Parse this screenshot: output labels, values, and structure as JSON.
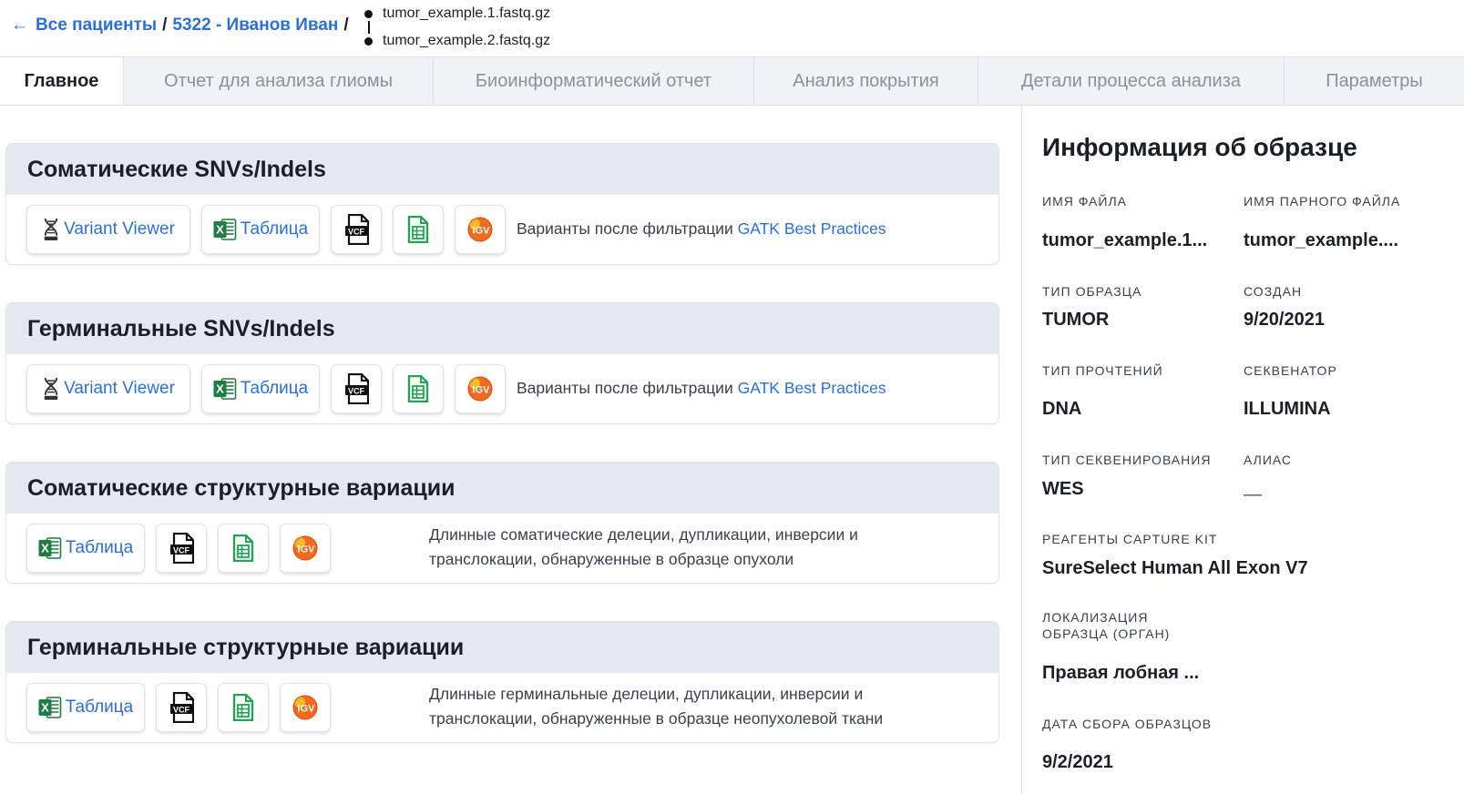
{
  "breadcrumb": {
    "back_label": "Все пациенты",
    "patient_label": "5322 - Иванов Иван",
    "separator": "/"
  },
  "files": [
    "tumor_example.1.fastq.gz",
    "tumor_example.2.fastq.gz"
  ],
  "tabs": [
    {
      "label": "Главное",
      "active": true
    },
    {
      "label": "Отчет для анализа глиомы",
      "active": false
    },
    {
      "label": "Биоинформатический отчет",
      "active": false
    },
    {
      "label": "Анализ покрытия",
      "active": false
    },
    {
      "label": "Детали процесса анализа",
      "active": false
    },
    {
      "label": "Параметры",
      "active": false
    }
  ],
  "sections": [
    {
      "title": "Соматические SNVs/Indels",
      "variant_viewer_label": "Variant Viewer",
      "table_label": "Таблица",
      "desc_prefix": "Варианты после фильтрации",
      "desc_link": "GATK Best Practices"
    },
    {
      "title": "Герминальные SNVs/Indels",
      "variant_viewer_label": "Variant Viewer",
      "table_label": "Таблица",
      "desc_prefix": "Варианты после фильтрации",
      "desc_link": "GATK Best Practices"
    },
    {
      "title": "Соматические структурные вариации",
      "table_label": "Таблица",
      "desc_line1": "Длинные соматические делеции, дупликации, инверсии и",
      "desc_line2": "транслокации, обнаруженные в образце опухоли"
    },
    {
      "title": "Герминальные структурные вариации",
      "table_label": "Таблица",
      "desc_line1": "Длинные герминальные делеции, дупликации, инверсии и",
      "desc_line2": "транслокации, обнаруженные в образце неопухолевой ткани"
    }
  ],
  "icons": {
    "vcf": "VCF",
    "igv": "IGV",
    "excel": "X"
  },
  "sample_info": {
    "title": "Информация об образце",
    "file_name_label": "Имя файла",
    "file_name_value": "tumor_example.1...",
    "pair_file_label": "Имя парного файла",
    "pair_file_value": "tumor_example....",
    "sample_type_label": "Тип образца",
    "sample_type_value": "TUMOR",
    "created_label": "Создан",
    "created_value": "9/20/2021",
    "read_type_label": "Тип прочтений",
    "read_type_value": "DNA",
    "sequencer_label": "Секвенатор",
    "sequencer_value": "ILLUMINA",
    "seq_type_label": "Тип секвенирования",
    "seq_type_value": "WES",
    "alias_label": "Алиас",
    "alias_value": "—",
    "capture_kit_label": "Реагенты Capture Kit",
    "capture_kit_value": "SureSelect Human All Exon V7",
    "localization_label_1": "Локализация",
    "localization_label_2": "образца (орган)",
    "localization_value": "Правая лобная ...",
    "collection_date_label": "Дата сбора образцов",
    "collection_date_value": "9/2/2021"
  },
  "colors": {
    "link": "#2b6fd6",
    "card_header": "#e5e8ee",
    "excel_green": "#1e7c45",
    "sheets_green": "#22a454",
    "igv_orange": "#f26a1b"
  }
}
